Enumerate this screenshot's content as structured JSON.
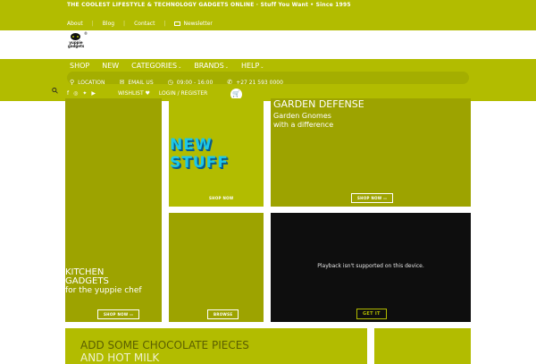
{
  "header": {
    "tagline": "THE COOLEST LIFESTYLE & TECHNOLOGY GADGETS ONLINE · Stuff You Want • Since 1995",
    "top_links": [
      "About",
      "Blog",
      "Contact",
      "Newsletter"
    ]
  },
  "logo": {
    "line1": "yuppie",
    "line2": "gadgets",
    "mark": "®"
  },
  "nav": {
    "items": [
      {
        "label": "SHOP",
        "caret": false
      },
      {
        "label": "NEW",
        "caret": false
      },
      {
        "label": "CATEGORIES",
        "caret": true
      },
      {
        "label": "BRANDS",
        "caret": true
      },
      {
        "label": "HELP",
        "caret": true
      }
    ],
    "info": {
      "location": "LOCATION",
      "email": "EMAIL US",
      "hours": "09:00 - 16:00",
      "phone": "+27 21 593 0000"
    },
    "wishlist": "WISHLIST",
    "login": "LOGIN / REGISTER"
  },
  "tiles": {
    "kitchen": {
      "title": "KITCHEN GADGETS",
      "subtitle": "for the yuppie chef",
      "button": "SHOP NOW"
    },
    "new_stuff": {
      "title": "NEW STUFF",
      "button": "SHOP NOW"
    },
    "garden": {
      "title": "GARDEN DEFENSE",
      "subtitle": "Garden Gnomes with a difference",
      "button": "SHOP NOW"
    },
    "browse": {
      "button": "BROWSE"
    },
    "video": {
      "message": "Playback isn't supported on this device.",
      "button": "GET IT"
    },
    "bottom": {
      "line1": "ADD SOME CHOCOLATE PIECES",
      "line2": "AND HOT MILK"
    }
  },
  "colors": {
    "accent": "#b2bc00",
    "dark_tile": "#9da300",
    "video_bg": "#0e0e0e"
  }
}
